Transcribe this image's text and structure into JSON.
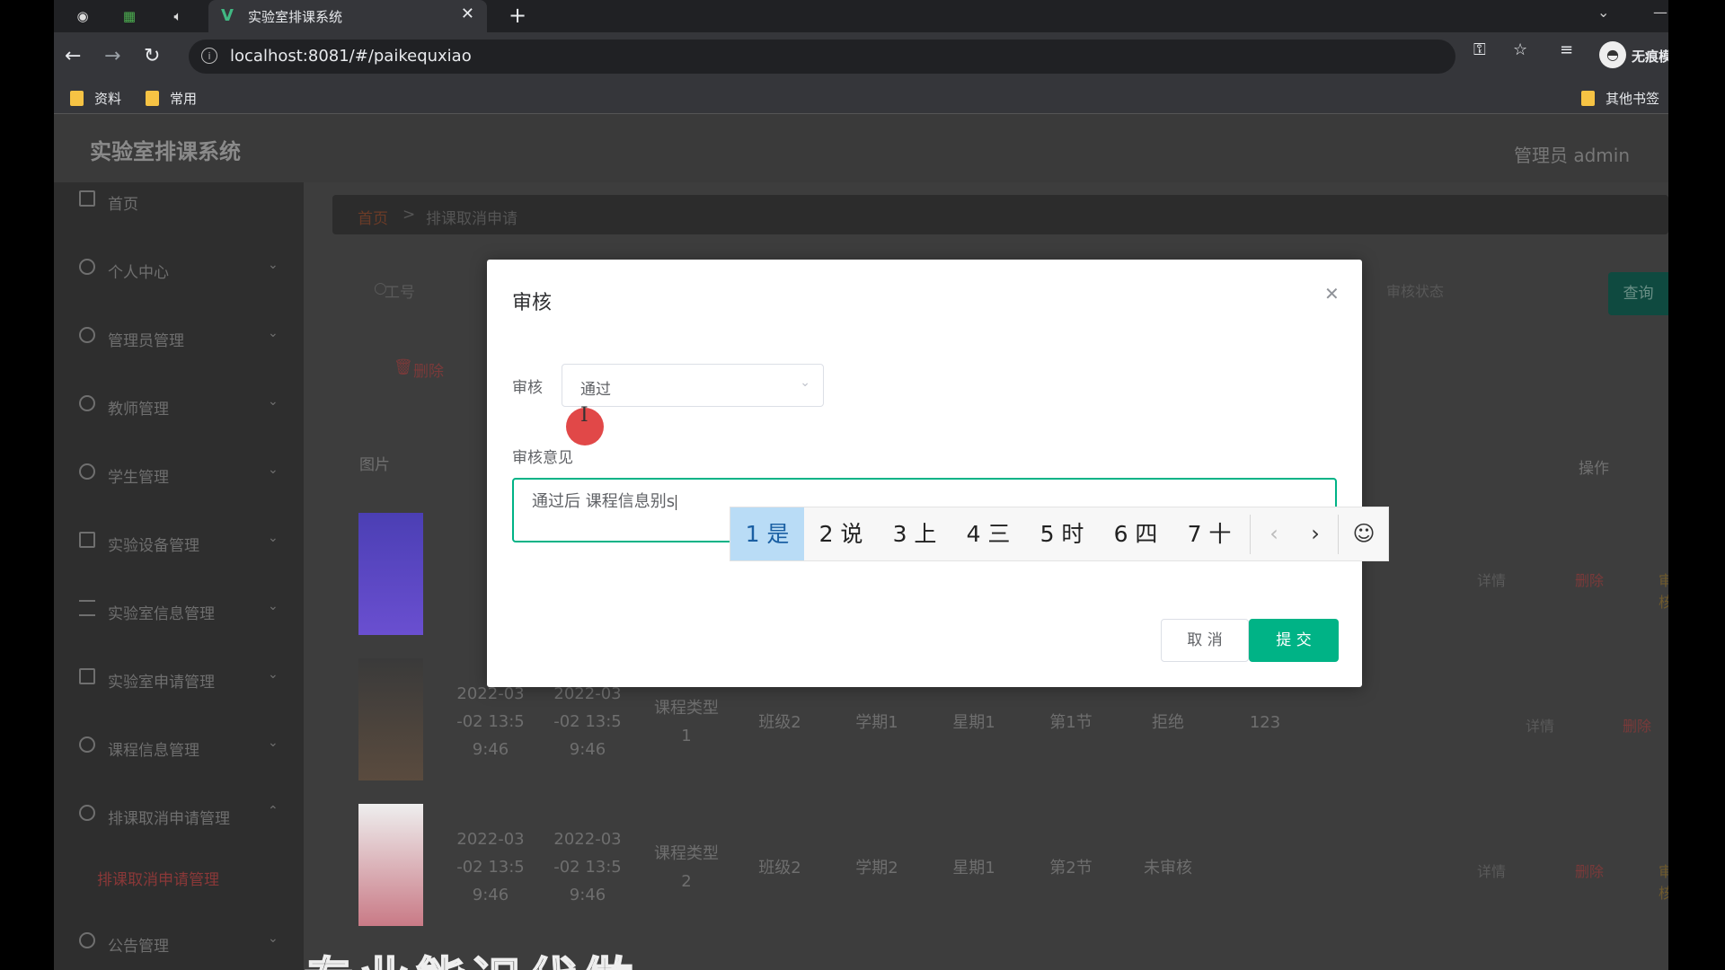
{
  "browser": {
    "tab_title": "实验室排课系统",
    "url": "localhost:8081/#/paikequxiao",
    "profile_name": "无痕模",
    "bookmarks": [
      "资料",
      "常用"
    ],
    "other_bookmarks": "其他书签"
  },
  "app": {
    "title": "实验室排课系统",
    "user": "管理员 admin"
  },
  "sidebar": {
    "items": [
      {
        "label": "首页"
      },
      {
        "label": "个人中心"
      },
      {
        "label": "管理员管理"
      },
      {
        "label": "教师管理"
      },
      {
        "label": "学生管理"
      },
      {
        "label": "实验设备管理"
      },
      {
        "label": "实验室信息管理"
      },
      {
        "label": "实验室申请管理"
      },
      {
        "label": "课程信息管理"
      },
      {
        "label": "排课取消申请管理"
      },
      {
        "label": "公告管理"
      }
    ],
    "active_sub": "排课取消申请管理"
  },
  "breadcrumb": {
    "home": "首页",
    "sep": ">",
    "current": "排课取消申请"
  },
  "toolbar": {
    "filter_placeholder": "工号",
    "select_placeholder": "审核状态",
    "query": "查询",
    "delete": "删除"
  },
  "table": {
    "photo_header": "图片",
    "ops_header": "操作",
    "rows": [
      {
        "start": [
          "2022-03",
          "-02 13:5",
          "9:46"
        ],
        "end": [
          "2022-03",
          "-02 13:5",
          "9:46"
        ],
        "type": [
          "课程类型",
          "1"
        ],
        "class": "班级2",
        "term": "学期1",
        "day": "星期1",
        "period": "第1节",
        "status": "拒绝",
        "opinion": "123"
      },
      {
        "start": [
          "2022-03",
          "-02 13:5",
          "9:46"
        ],
        "end": [
          "2022-03",
          "-02 13:5",
          "9:46"
        ],
        "type": [
          "课程类型",
          "2"
        ],
        "class": "班级2",
        "term": "学期2",
        "day": "星期1",
        "period": "第2节",
        "status": "未审核",
        "opinion": ""
      }
    ],
    "ops": {
      "detail": "详情",
      "delete": "删除",
      "review": "审核"
    }
  },
  "dialog": {
    "title": "审核",
    "status_label": "审核",
    "status_value": "通过",
    "opinion_label": "审核意见",
    "opinion_value": "通过后 课程信息别s",
    "cancel": "取 消",
    "submit": "提 交"
  },
  "ime": {
    "candidates": [
      {
        "num": "1",
        "text": "是"
      },
      {
        "num": "2",
        "text": "说"
      },
      {
        "num": "3",
        "text": "上"
      },
      {
        "num": "4",
        "text": "三"
      },
      {
        "num": "5",
        "text": "时"
      },
      {
        "num": "6",
        "text": "四"
      },
      {
        "num": "7",
        "text": "十"
      }
    ],
    "prev": "‹",
    "next": "›",
    "emoji": "☺"
  },
  "subtitle": "专业能识代做"
}
